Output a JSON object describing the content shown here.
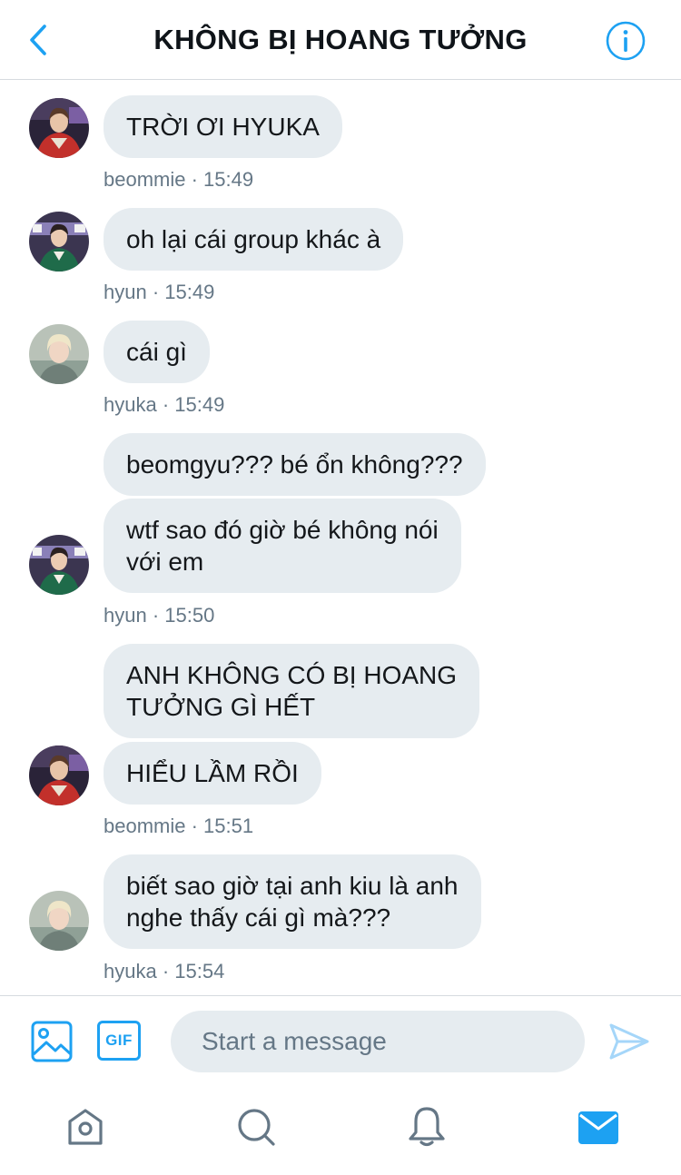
{
  "header": {
    "title": "KHÔNG BỊ HOANG TƯỞNG",
    "back_icon": "chevron-left-icon",
    "info_icon": "info-icon"
  },
  "messages": [
    {
      "text": "TRỜI ƠI HYUKA",
      "meta": "beommie · 15:49"
    },
    {
      "text": "oh lại cái group khác à",
      "meta": "hyun · 15:49"
    },
    {
      "text": "cái gì",
      "meta": "hyuka · 15:49"
    },
    {
      "text": "beomgyu??? bé ổn không???"
    },
    {
      "line1": "wtf sao đó giờ bé không nói",
      "line2": "với em",
      "meta": "hyun · 15:50"
    },
    {
      "line1": "ANH KHÔNG CÓ BỊ HOANG",
      "line2": "TƯỞNG GÌ HẾT"
    },
    {
      "text": "HIỂU LẦM RỒI",
      "meta": "beommie · 15:51"
    },
    {
      "line1": "biết sao giờ tại anh kiu là anh",
      "line2": "nghe thấy cái gì mà???",
      "meta": "hyuka · 15:54"
    }
  ],
  "composer": {
    "placeholder": "Start a message",
    "gif_label": "GIF",
    "image_icon": "image-icon",
    "send_icon": "send-icon"
  },
  "tabbar": {
    "icons": [
      "home-icon",
      "search-icon",
      "notifications-icon",
      "messages-icon"
    ]
  },
  "colors": {
    "accent": "#1da1f2",
    "bubble": "#e6ecf0",
    "meta_text": "#657786",
    "tab_icon": "#657786"
  }
}
